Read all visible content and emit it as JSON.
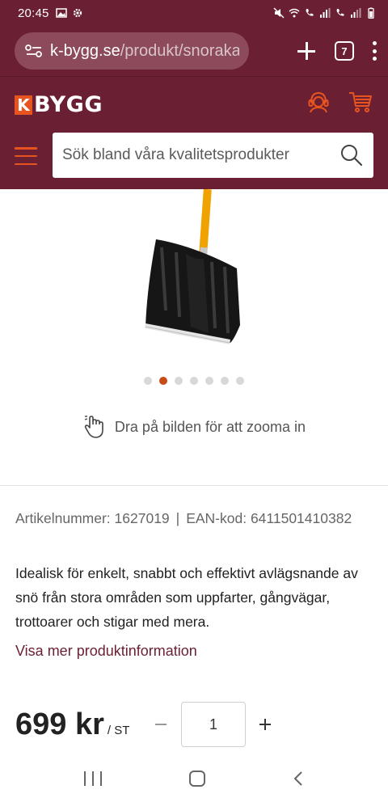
{
  "status_bar": {
    "time": "20:45"
  },
  "browser": {
    "url_domain": "k-bygg.se",
    "url_path": "/produkt/snoraka",
    "tab_count": "7"
  },
  "header": {
    "logo_mark": "K",
    "logo_text": "BYGG",
    "search_placeholder": "Sök bland våra kvalitetsprodukter"
  },
  "gallery": {
    "dot_count": 7,
    "active_dot": 1,
    "zoom_hint": "Dra på bilden för att zooma in"
  },
  "product": {
    "article_label": "Artikelnummer: 1627019",
    "separator": "|",
    "ean_label": "EAN-kod: 6411501410382",
    "description": "Idealisk för enkelt, snabbt och effektivt avlägsnande av snö från stora områden som uppfarter, gångvägar, trottoarer och stigar med mera.",
    "more_info_link": "Visa mer produktinformation",
    "price": "699 kr",
    "unit": "/ ST",
    "quantity": "1"
  },
  "colors": {
    "brand": "#6b1f33",
    "accent": "#e8541f"
  }
}
